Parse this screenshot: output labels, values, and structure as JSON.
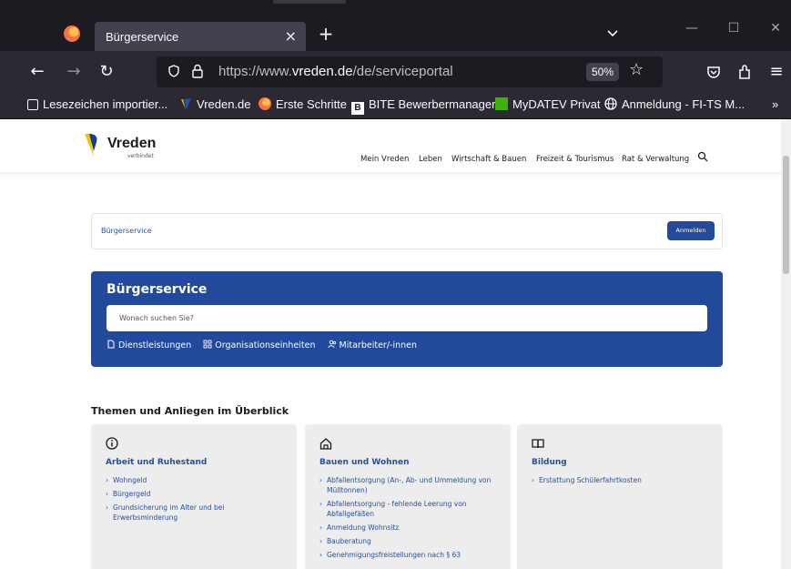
{
  "browser": {
    "tab": {
      "title": "Bürgerservice"
    },
    "url": {
      "prefix": "https://www.",
      "domain": "vreden.de",
      "path": "/de/serviceportal"
    },
    "zoom": "50%",
    "bookmarks": [
      {
        "label": "Lesezeichen importier...",
        "icon": "import-icon"
      },
      {
        "label": "Vreden.de",
        "icon": "vreden-icon"
      },
      {
        "label": "Erste Schritte",
        "icon": "firefox-icon"
      },
      {
        "label": "BITE Bewerbermanager",
        "icon": "bite-icon"
      },
      {
        "label": "MyDATEV Privat",
        "icon": "datev-icon"
      },
      {
        "label": "Anmeldung - FI-TS M...",
        "icon": "globe-icon"
      }
    ]
  },
  "site": {
    "logo": {
      "name": "Vreden",
      "tagline": "verbindet"
    },
    "nav": [
      "Mein Vreden",
      "Leben",
      "Wirtschaft & Bauen",
      "Freizeit & Tourismus",
      "Rat & Verwaltung"
    ],
    "breadcrumb": "Bürgerservice",
    "login_label": "Anmelden",
    "hero": {
      "title": "Bürgerservice",
      "search_placeholder": "Wonach suchen Sie?",
      "links": [
        "Dienstleistungen",
        "Organisationseinheiten",
        "Mitarbeiter/-innen"
      ]
    },
    "section_title": "Themen und Anliegen im Überblick",
    "cards": [
      {
        "icon": "info-icon",
        "title": "Arbeit und Ruhestand",
        "items": [
          "Wohngeld",
          "Bürgergeld",
          "Grundsicherung im Alter und bei Erwerbsminderung"
        ]
      },
      {
        "icon": "home-icon",
        "title": "Bauen und Wohnen",
        "items": [
          "Abfallentsorgung (An-, Ab- und Ummeldung von Mülltonnen)",
          "Abfallentsorgung - fehlende Leerung von Abfallgefäßen",
          "Anmeldung Wohnsitz",
          "Bauberatung",
          "Genehmigungsfreistellungen nach § 63"
        ]
      },
      {
        "icon": "book-icon",
        "title": "Bildung",
        "items": [
          "Erstattung Schülerfahrtkosten"
        ]
      }
    ]
  },
  "colors": {
    "brand_blue": "#23499c",
    "link_blue": "#2350a5",
    "browser_dark": "#1c1b22"
  }
}
